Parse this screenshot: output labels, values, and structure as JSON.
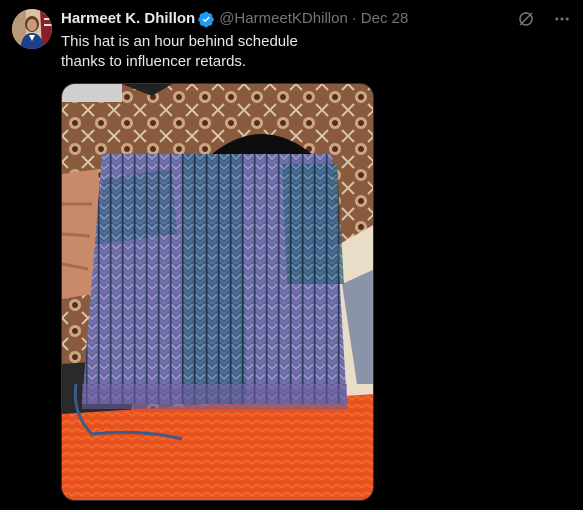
{
  "tweet": {
    "display_name": "Harmeet K. Dhillon",
    "handle": "@HarmeetKDhillon",
    "separator": "·",
    "date": "Dec 28",
    "text_lines": [
      "This hat is an hour behind schedule",
      "thanks to influencer retards."
    ]
  },
  "icons": {
    "verified": "verified-badge-icon",
    "grok": "grok-icon",
    "more": "more-options-icon"
  },
  "colors": {
    "background": "#000000",
    "text": "#e7e9ea",
    "muted": "#71767b",
    "verified": "#1d9bf0"
  },
  "media": {
    "description_type": "photo"
  }
}
